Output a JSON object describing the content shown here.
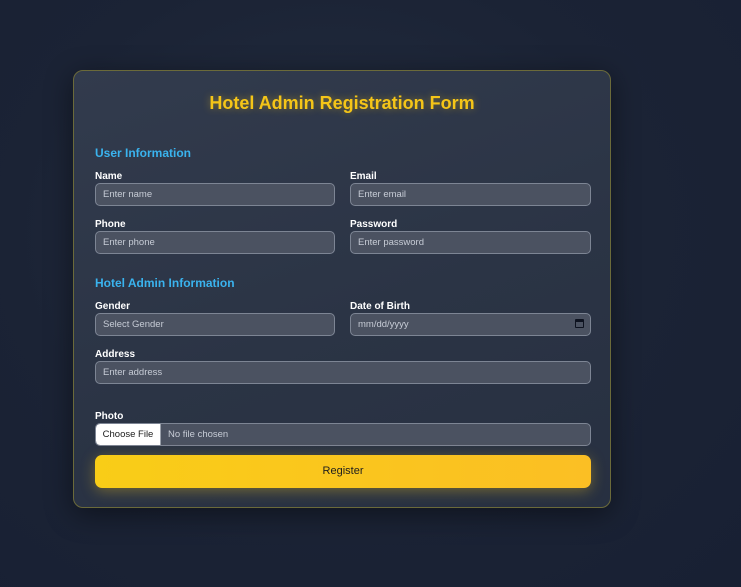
{
  "form": {
    "title": "Hotel Admin Registration Form",
    "user_section": {
      "title": "User Information",
      "name_label": "Name",
      "name_placeholder": "Enter name",
      "email_label": "Email",
      "email_placeholder": "Enter email",
      "phone_label": "Phone",
      "phone_placeholder": "Enter phone",
      "password_label": "Password",
      "password_placeholder": "Enter password"
    },
    "admin_section": {
      "title": "Hotel Admin Information",
      "gender_label": "Gender",
      "gender_value": "Select Gender",
      "dob_label": "Date of Birth",
      "dob_placeholder": "mm/dd/yyyy",
      "address_label": "Address",
      "address_placeholder": "Enter address",
      "photo_label": "Photo",
      "file_button_label": "Choose File",
      "file_status": "No file chosen"
    },
    "register_label": "Register"
  },
  "colors": {
    "accent_yellow": "#f5c518",
    "section_blue": "#3ab3ee",
    "background": "#1a2233"
  },
  "icons": {
    "date_picker": "calendar-icon"
  }
}
